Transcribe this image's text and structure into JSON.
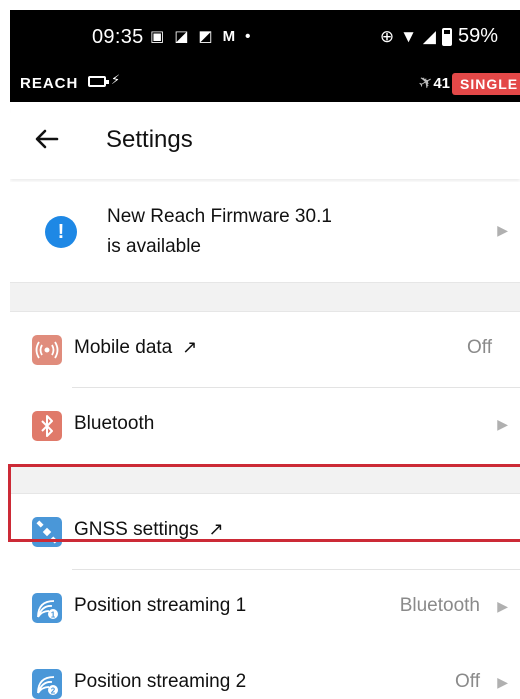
{
  "status_bar": {
    "time": "09:35",
    "notification_icons": [
      "teams-icon",
      "outlook-icon",
      "office-icon",
      "gmail-icon",
      "dot-icon"
    ],
    "battery_percent": "59%"
  },
  "app_bar": {
    "name": "REACH",
    "satellite_count": "41",
    "solution_status": "SINGLE",
    "solution_color": "#e34848"
  },
  "toolbar": {
    "title": "Settings"
  },
  "firmware": {
    "line1": "New Reach Firmware 30.1",
    "line2": "is available"
  },
  "rows": [
    {
      "label": "Mobile data",
      "value": "Off",
      "icon": "antenna-icon",
      "icon_color": "#e08c7c",
      "external": true,
      "chevron": false
    },
    {
      "label": "Bluetooth",
      "value": "",
      "icon": "bluetooth-icon",
      "icon_color": "#e07a6a",
      "external": false,
      "chevron": true
    },
    {
      "label": "GNSS settings",
      "value": "",
      "icon": "satellite-icon",
      "icon_color": "#4a97d8",
      "external": true,
      "chevron": false
    },
    {
      "label": "Position streaming 1",
      "value": "Bluetooth",
      "icon": "stream-1-icon",
      "icon_color": "#4a97d8",
      "external": false,
      "chevron": true
    },
    {
      "label": "Position streaming 2",
      "value": "Off",
      "icon": "stream-2-icon",
      "icon_color": "#4a97d8",
      "external": false,
      "chevron": true
    }
  ],
  "highlight_color": "#cc2a36"
}
